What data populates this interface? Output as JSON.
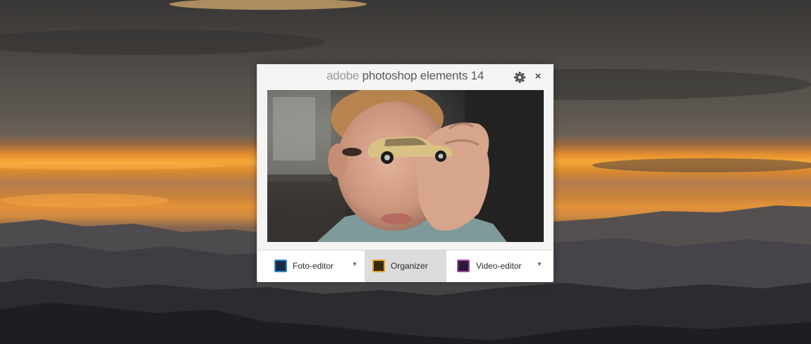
{
  "launcher": {
    "title_brand": "adobe",
    "title_product": "photoshop elements 14",
    "settings_icon": "gear-icon",
    "close_glyph": "×",
    "hero_image": "boy-holding-toy-car-photo"
  },
  "apps": [
    {
      "label": "Foto-editor",
      "icon": "photo-editor-icon",
      "icon_color": "#2a86c9",
      "has_dropdown": true
    },
    {
      "label": "Organizer",
      "icon": "organizer-icon",
      "icon_color": "#e3a125",
      "active": true,
      "has_dropdown": false
    },
    {
      "label": "Video-editor",
      "icon": "video-editor-icon",
      "icon_color": "#9a4ea8",
      "has_dropdown": true
    }
  ],
  "dropdown_glyph": "▼",
  "colors": {
    "window_bg": "#f4f4f4",
    "active_button": "#dcdcdc"
  }
}
